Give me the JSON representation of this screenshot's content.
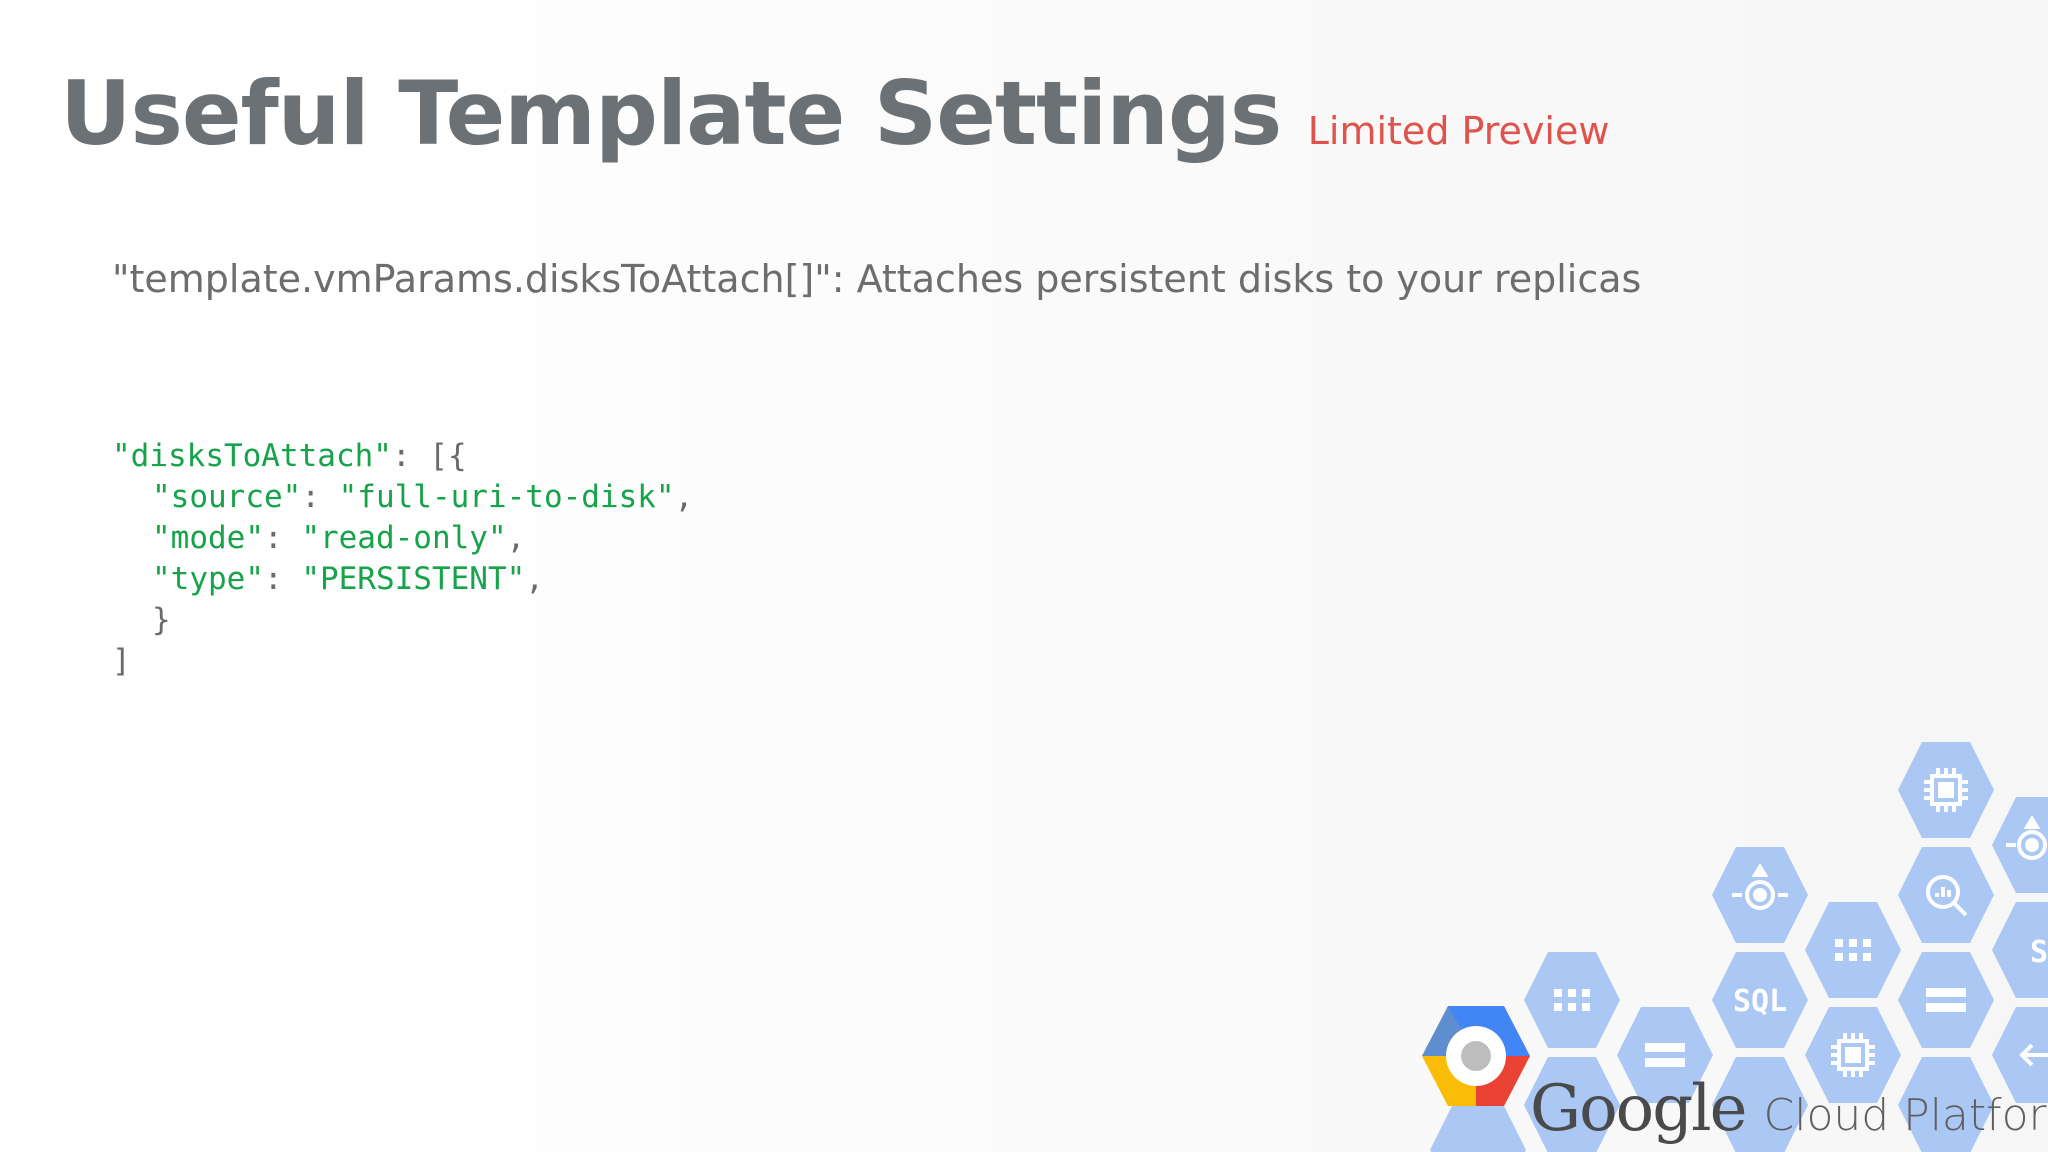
{
  "slide": {
    "title": "Useful Template Settings",
    "badge": "Limited Preview",
    "description": "\"template.vmParams.disksToAttach[]\": Attaches persistent disks to your replicas"
  },
  "code": {
    "line1_key": "\"disksToAttach\"",
    "line1_rest": ": [{",
    "line2_key": "\"source\"",
    "line2_sep": ": ",
    "line2_val": "\"full-uri-to-disk\"",
    "line2_end": ",",
    "line3_key": "\"mode\"",
    "line3_sep": ": ",
    "line3_val": "\"read-only\"",
    "line3_end": ",",
    "line4_key": "\"type\"",
    "line4_sep": ": ",
    "line4_val": "\"PERSISTENT\"",
    "line4_end": ",",
    "line5": "}",
    "line6": "]"
  },
  "branding": {
    "google": "Google",
    "cloud_platform": "Cloud Platform"
  },
  "hex_labels": {
    "sql": "SQL"
  },
  "colors": {
    "title": "#6b7174",
    "badge": "#e0534d",
    "code_string": "#16a34a",
    "hex_fill": "#a4c2f4",
    "logo_blue": "#4285f4",
    "logo_red": "#ea4335",
    "logo_yellow": "#fbbc05"
  },
  "icons": [
    "chip-icon",
    "lens-icon",
    "analytics-icon",
    "sql-icon",
    "grid-icon",
    "storage-icon",
    "arrow-icon",
    "gcp-hexagon-logo"
  ]
}
